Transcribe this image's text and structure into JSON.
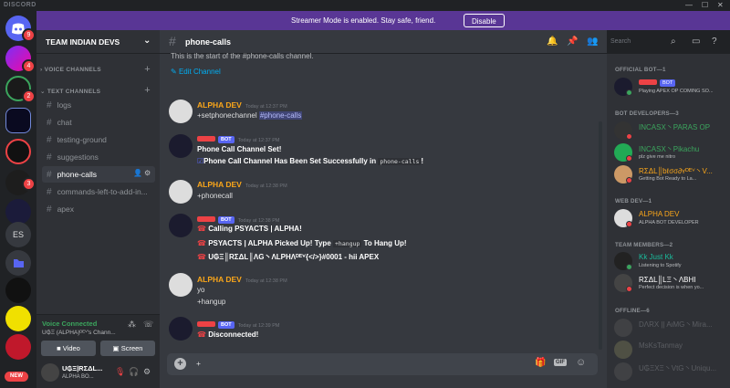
{
  "window": {
    "title": "DISCORD",
    "controls": [
      "—",
      "☐",
      "✕"
    ]
  },
  "banner": {
    "message": "Streamer Mode is enabled. Stay safe, friend.",
    "button": "Disable"
  },
  "guilds": {
    "badges": {
      "home": "9",
      "g1": "4",
      "g2": "2",
      "g6": "3"
    },
    "es_label": "ES",
    "new_label": "NEW"
  },
  "server": {
    "name": "TEAM INDIAN DEVS",
    "categories": {
      "voice": "VOICE CHANNELS",
      "text": "TEXT CHANNELS"
    },
    "channels": [
      "logs",
      "chat",
      "testing-ground",
      "suggestions",
      "phone-calls",
      "commands-left-to-add-in...",
      "apex"
    ]
  },
  "voice": {
    "status": "Voice Connected",
    "detail": "U₲Ξ (ALPHA)ᴰᴱⱽ's Chann...",
    "video": "Video",
    "screen": "Screen"
  },
  "user": {
    "name": "U₲Ξ|RΣΔL...",
    "tag": "ALPHA BO..."
  },
  "channel": {
    "name": "phone-calls",
    "start_text": "This is the start of the #phone-calls channel.",
    "edit": "Edit Channel",
    "search_placeholder": "Search"
  },
  "messages": [
    {
      "author": "ALPHA DEV",
      "bot": "",
      "time": "Today at 12:37 PM",
      "lines": [
        "+setphonechannel "
      ],
      "mention": "#phone-calls"
    },
    {
      "author": "",
      "bot": "BOT",
      "time": "Today at 12:37 PM",
      "lines": [
        "Phone Call Channel Set!",
        "Phone Call Channel Has Been Set Successfully in ",
        "!"
      ],
      "code": "phone-calls"
    },
    {
      "author": "ALPHA DEV",
      "bot": "",
      "time": "Today at 12:38 PM",
      "lines": [
        "+phonecall"
      ]
    },
    {
      "author": "",
      "bot": "BOT",
      "time": "Today at 12:38 PM",
      "lines": [
        "Calling PSYACTS | ALPHA!",
        "PSYACTS | ALPHA Picked Up! Type ",
        " To Hang Up!",
        "U₲Ξ║RΣΔL║ΛG丶ΛLPHΛᴰᴱⱽ{</>}#0001 - hii APEX"
      ],
      "code": "+hangup"
    },
    {
      "author": "ALPHA DEV",
      "bot": "",
      "time": "Today at 12:38 PM",
      "lines": [
        "yo",
        "+hangup"
      ]
    },
    {
      "author": "",
      "bot": "BOT",
      "time": "Today at 12:39 PM",
      "lines": [
        "Disconnected!"
      ]
    }
  ],
  "composer": {
    "value": "+",
    "gif": "GIF"
  },
  "members": {
    "groups": [
      {
        "title": "OFFICIAL BOT—1",
        "items": [
          {
            "name": "",
            "status": "Playing APEX OP COMING SO...",
            "color": "#ed4245",
            "bot": "BOT"
          }
        ]
      },
      {
        "title": "BOT DEVELOPERS—3",
        "items": [
          {
            "name": "INCASX丶PARAS OP",
            "status": "",
            "color": "#3ba55d"
          },
          {
            "name": "INCASX丶Pikachu",
            "status": "plz give me nitro",
            "color": "#3ba55d"
          },
          {
            "name": "RΣΔL║ƅℓσσ∂ʏᴰᴱⱽ丶V...",
            "status": "Getting Bot Ready to La...",
            "color": "#faa61a"
          }
        ]
      },
      {
        "title": "WEB DEV—1",
        "items": [
          {
            "name": "ALPHA DEV",
            "status": "ALPHA BOT DEVELOPER",
            "color": "#faa61a"
          }
        ]
      },
      {
        "title": "TEAM MEMBERS—2",
        "items": [
          {
            "name": "Kk Just Kk",
            "status": "Listening to Spotify",
            "color": "#1abc9c"
          },
          {
            "name": "RΣΔL║LΞ丶ΛBHI",
            "status": "Perfect decision is when yo...",
            "color": "#ffffff"
          }
        ]
      },
      {
        "title": "OFFLINE—6",
        "items": [
          {
            "name": "DΛRX || AιMG丶Mira...",
            "status": "",
            "color": "#8e9297"
          },
          {
            "name": "MsKsTanmay",
            "status": "",
            "color": "#8e9297"
          },
          {
            "name": "U₲ΞXΞ丶VtG丶Uniqu...",
            "status": "",
            "color": "#8e9297"
          }
        ]
      }
    ]
  },
  "colors": {
    "accent": "#5865f2",
    "banner": "#593695",
    "author": "#faa61a",
    "botname": "#ed4245",
    "online": "#3ba55d",
    "dnd": "#ed4245"
  }
}
